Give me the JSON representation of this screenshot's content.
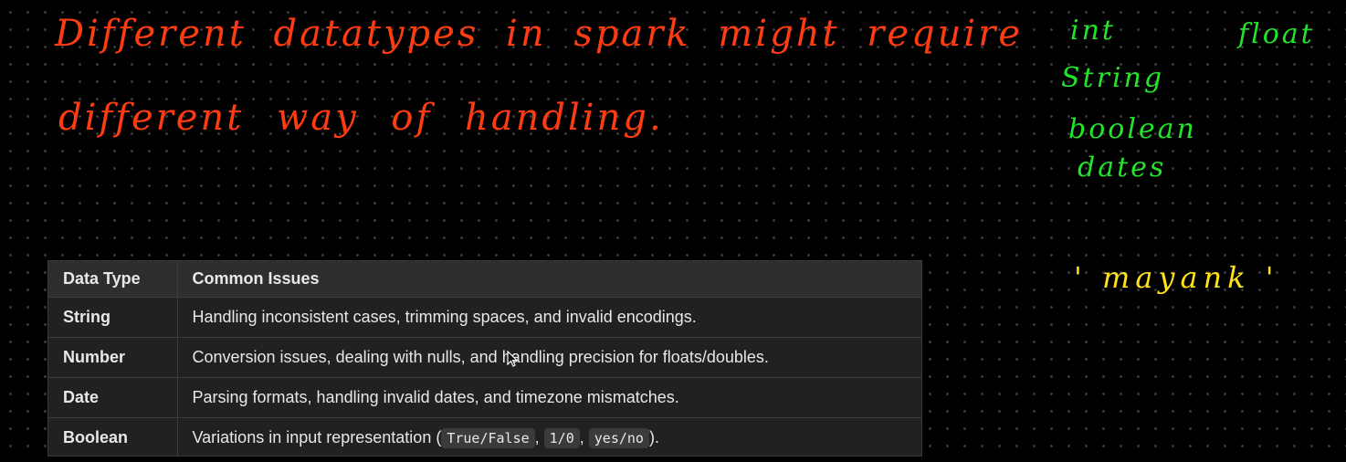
{
  "handwriting": {
    "red_line_1": "Different datatypes in spark might require",
    "red_line_2": "different way of handling.",
    "green_int": "int",
    "green_float": "float",
    "green_string": "String",
    "green_boolean": "boolean",
    "green_dates": "dates",
    "yellow_example": "' mayank '"
  },
  "table": {
    "headers": [
      "Data Type",
      "Common Issues"
    ],
    "rows": [
      {
        "type": "String",
        "issue": "Handling inconsistent cases, trimming spaces, and invalid encodings."
      },
      {
        "type": "Number",
        "issue": "Conversion issues, dealing with nulls, and handling precision for floats/doubles."
      },
      {
        "type": "Date",
        "issue": "Parsing formats, handling invalid dates, and timezone mismatches."
      },
      {
        "type": "Boolean",
        "issue_prefix": "Variations in input representation (",
        "code_1": "True/False",
        "sep_1": ", ",
        "code_2": "1/0",
        "sep_2": ", ",
        "code_3": "yes/no",
        "issue_suffix": ")."
      }
    ]
  },
  "colors": {
    "background": "#000000",
    "red_ink": "#ff3b12",
    "green_ink": "#22e52a",
    "yellow_ink": "#ffe11a",
    "table_bg": "#212121",
    "table_header_bg": "#2e2e2e"
  },
  "icons": {
    "cursor": "mouse-pointer-icon"
  }
}
